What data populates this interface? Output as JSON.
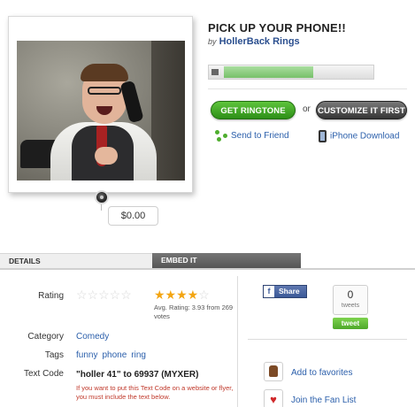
{
  "ringtone": {
    "title": "PICK UP YOUR PHONE!!",
    "by_label": "by",
    "artist": "HollerBack Rings",
    "price": "$0.00",
    "progress": 0.6
  },
  "actions": {
    "get_ringtone": "GET RINGTONE",
    "or": "or",
    "customize": "CUSTOMIZE IT FIRST",
    "send_to_friend": "Send to Friend",
    "iphone_download": "iPhone Download"
  },
  "tabs": {
    "details": "DETAILS",
    "embed": "EMBED IT"
  },
  "details": {
    "rating_label": "Rating",
    "user_stars": "☆☆☆☆☆",
    "avg_stars_on": "★★★★",
    "avg_stars_off": "☆",
    "avg_text": "Avg. Rating: 3.93 from 269 votes",
    "category_label": "Category",
    "category": "Comedy",
    "tags_label": "Tags",
    "tags": [
      "funny",
      "phone",
      "ring"
    ],
    "text_code_label": "Text Code",
    "text_code": "\"holler 41\" to 69937 (MYXER)",
    "text_code_note": "If you want to put this Text Code on a website or flyer, you must include the text below."
  },
  "social": {
    "fb_f": "f",
    "fb_share": "Share",
    "tweet_count": "0",
    "tweets_label": "tweets",
    "tweet_button": "tweet",
    "add_favorites": "Add to favorites",
    "fan_list": "Join the Fan List"
  },
  "colors": {
    "link": "#2b5fab",
    "accent_green": "#2d8f17",
    "star": "#f3a512",
    "facebook": "#3b5998"
  }
}
